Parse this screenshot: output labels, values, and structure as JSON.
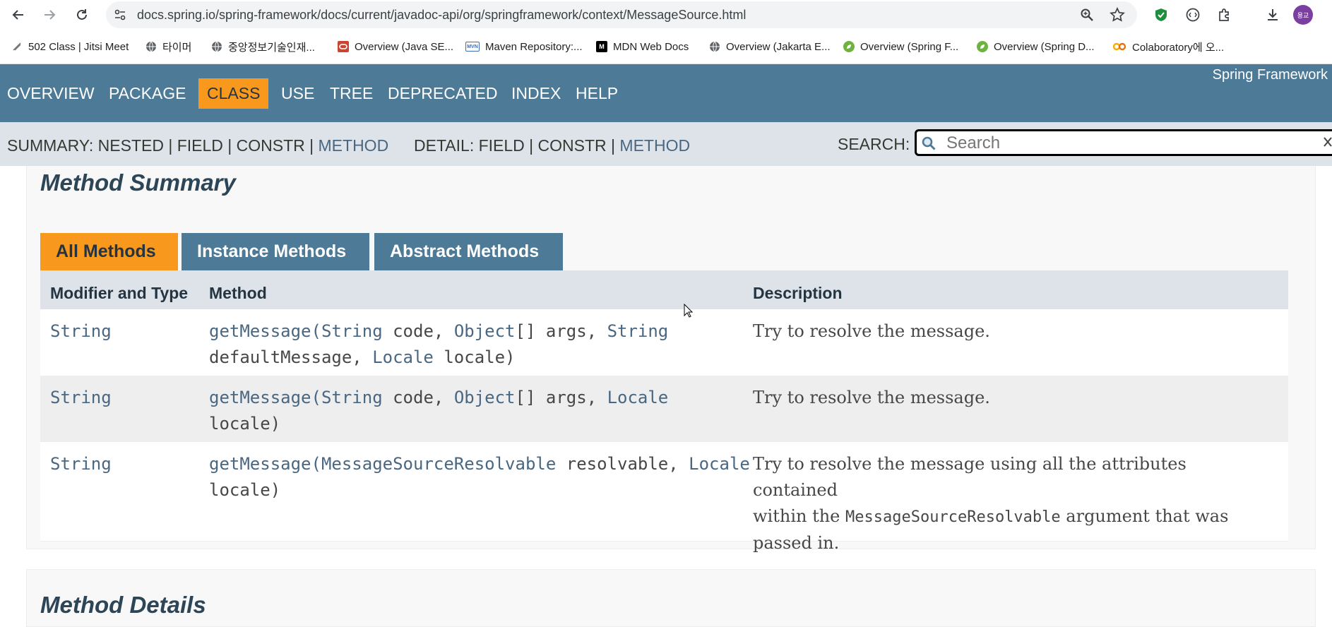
{
  "browser": {
    "url": "docs.spring.io/spring-framework/docs/current/javadoc-api/org/springframework/context/MessageSource.html",
    "avatar_text": "용교",
    "bookmarks": [
      {
        "label": "502 Class | Jitsi Meet",
        "icon": "jitsi-icon"
      },
      {
        "label": "타이머",
        "icon": "globe-icon"
      },
      {
        "label": "중앙정보기술인재...",
        "icon": "globe-icon"
      },
      {
        "label": "Overview (Java SE...",
        "icon": "oracle-icon"
      },
      {
        "label": "Maven Repository:...",
        "icon": "maven-icon"
      },
      {
        "label": "MDN Web Docs",
        "icon": "mdn-icon"
      },
      {
        "label": "Overview (Jakarta E...",
        "icon": "globe-icon"
      },
      {
        "label": "Overview (Spring F...",
        "icon": "spring-icon"
      },
      {
        "label": "Overview (Spring D...",
        "icon": "spring-icon"
      },
      {
        "label": "Colaboratory에 오...",
        "icon": "colab-icon"
      }
    ]
  },
  "topnav": {
    "items": [
      "OVERVIEW",
      "PACKAGE",
      "CLASS",
      "USE",
      "TREE",
      "DEPRECATED",
      "INDEX",
      "HELP"
    ],
    "active": "CLASS",
    "product": "Spring Framework"
  },
  "subnav": {
    "summary_prefix": "SUMMARY: NESTED | FIELD | CONSTR |",
    "summary_link": "METHOD",
    "detail_prefix": "DETAIL: FIELD | CONSTR |",
    "detail_link": "METHOD",
    "search_label": "SEARCH:",
    "search_placeholder": "Search"
  },
  "method_summary": {
    "heading": "Method Summary",
    "tabs": [
      "All Methods",
      "Instance Methods",
      "Abstract Methods"
    ],
    "columns": [
      "Modifier and Type",
      "Method",
      "Description"
    ],
    "rows": [
      {
        "type": "String",
        "method_name": "getMessage",
        "line1": [
          "(",
          "String",
          " code, ",
          "Object",
          "[] args, ",
          "String"
        ],
        "line2": [
          " defaultMessage, ",
          "Locale",
          " locale)"
        ],
        "description": "Try to resolve the message."
      },
      {
        "type": "String",
        "method_name": "getMessage",
        "line1": [
          "(",
          "String",
          " code, ",
          "Object",
          "[] args, ",
          "Locale"
        ],
        "line2": [
          " locale)"
        ],
        "description": "Try to resolve the message."
      },
      {
        "type": "String",
        "method_name": "getMessage",
        "line1": [
          "(",
          "MessageSourceResolvable",
          " resolvable, ",
          "Locale"
        ],
        "line2": [
          " locale)"
        ],
        "description_a": "Try to resolve the message using all the attributes contained",
        "description_b": "within the ",
        "description_code": "MessageSourceResolvable",
        "description_c": " argument that was",
        "description_d": "passed in."
      }
    ]
  },
  "method_details": {
    "heading": "Method Details"
  }
}
